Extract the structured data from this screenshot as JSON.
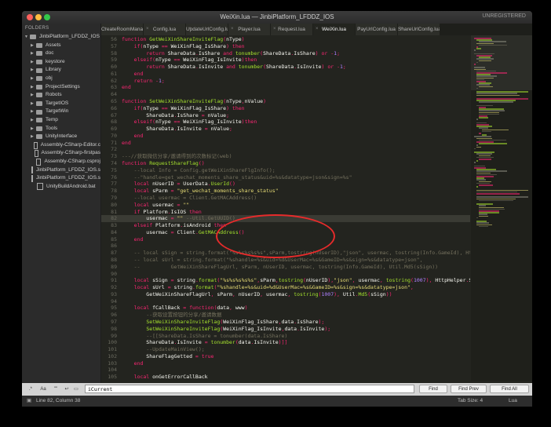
{
  "window": {
    "title": "WeiXin.lua — JinbiPlatform_LFDDZ_IOS",
    "registration": "UNREGISTERED"
  },
  "sidebar": {
    "header": "FOLDERS",
    "items": [
      {
        "label": "JinbiPlatform_LFDDZ_IOS",
        "kind": "folder",
        "expanded": true,
        "depth": 0
      },
      {
        "label": "Assets",
        "kind": "folder",
        "depth": 1
      },
      {
        "label": "doc",
        "kind": "folder",
        "depth": 1
      },
      {
        "label": "keystore",
        "kind": "folder",
        "depth": 1
      },
      {
        "label": "Library",
        "kind": "folder",
        "depth": 1
      },
      {
        "label": "obj",
        "kind": "folder",
        "depth": 1
      },
      {
        "label": "ProjectSettings",
        "kind": "folder",
        "depth": 1
      },
      {
        "label": "Robots",
        "kind": "folder",
        "depth": 1
      },
      {
        "label": "TargetIOS",
        "kind": "folder",
        "depth": 1
      },
      {
        "label": "TargetWin",
        "kind": "folder",
        "depth": 1
      },
      {
        "label": "Temp",
        "kind": "folder",
        "depth": 1
      },
      {
        "label": "Tools",
        "kind": "folder",
        "depth": 1
      },
      {
        "label": "UnityInterface",
        "kind": "folder",
        "depth": 1
      },
      {
        "label": "Assembly-CSharp-Editor.c",
        "kind": "file",
        "depth": 1
      },
      {
        "label": "Assembly-CSharp-firstpas",
        "kind": "file",
        "depth": 1
      },
      {
        "label": "Assembly-CSharp.csproj",
        "kind": "file",
        "depth": 1
      },
      {
        "label": "JinbiPlatform_LFDDZ_IOS.s",
        "kind": "file",
        "depth": 1
      },
      {
        "label": "JinbiPlatform_LFDDZ_IOS.s",
        "kind": "file",
        "depth": 1
      },
      {
        "label": "UnityBuildAndroid.bat",
        "kind": "file",
        "depth": 1
      }
    ]
  },
  "tabs": [
    {
      "label": "CreateRoomManager.lua",
      "active": false
    },
    {
      "label": "Config.lua",
      "active": false
    },
    {
      "label": "UpdateUrlConfig.lua",
      "active": false
    },
    {
      "label": "Player.lua",
      "active": false
    },
    {
      "label": "Request.lua",
      "active": false
    },
    {
      "label": "WeiXin.lua",
      "active": true
    },
    {
      "label": "PayUrlConfig.lua",
      "active": false
    },
    {
      "label": "ShareUrlConfig.lua",
      "active": false
    }
  ],
  "editor": {
    "current_line": 82,
    "lines": [
      {
        "n": 56,
        "code": "function GetWeiXinShareInviteFlag(nType)"
      },
      {
        "n": 57,
        "code": "    if(nType == WeiXinFlag_IsShare) then"
      },
      {
        "n": 58,
        "code": "        return ShareData.IsShare and tonumber(ShareData.IsShare) or -1;"
      },
      {
        "n": 59,
        "code": "    elseif(nType == WeiXinFlag_IsInvite)then"
      },
      {
        "n": 60,
        "code": "        return ShareData.IsInvite and tonumber(ShareData.IsInvite) or -1;"
      },
      {
        "n": 61,
        "code": "    end"
      },
      {
        "n": 62,
        "code": "    return -1;"
      },
      {
        "n": 63,
        "code": "end"
      },
      {
        "n": 64,
        "code": ""
      },
      {
        "n": 65,
        "code": "function SetWeiXinShareInviteFlag(nType,nValue)"
      },
      {
        "n": 66,
        "code": "    if(nType == WeiXinFlag_IsShare) then"
      },
      {
        "n": 67,
        "code": "        ShareData.IsShare = nValue;"
      },
      {
        "n": 68,
        "code": "    elseif(nType == WeiXinFlag_IsInvite)then"
      },
      {
        "n": 69,
        "code": "        ShareData.IsInvite = nValue;"
      },
      {
        "n": 70,
        "code": "    end"
      },
      {
        "n": 71,
        "code": "end"
      },
      {
        "n": 72,
        "code": ""
      },
      {
        "n": 73,
        "code": "---//获取微信分享/邀请得到的次数标记(web)"
      },
      {
        "n": 74,
        "code": "function RequestShareFlag()"
      },
      {
        "n": 75,
        "code": "    --local Info = Config.getWeiXinShareFlgInfo();"
      },
      {
        "n": 76,
        "code": "    --\"handle=get_wechat_moments_share_status&uid=%s&datatype=json&sign=%s\""
      },
      {
        "n": 77,
        "code": "    local nUserID = UserData.UserId()"
      },
      {
        "n": 78,
        "code": "    local sParm = \"get_wechat_moments_share_status\""
      },
      {
        "n": 79,
        "code": "    --local usermac = Client.GetMACAddress()"
      },
      {
        "n": 80,
        "code": "    local usermac = \"\""
      },
      {
        "n": 81,
        "code": "    if Platform.IsIOS then"
      },
      {
        "n": 82,
        "code": "        usermac = \"\" --Util.GetUUID()"
      },
      {
        "n": 83,
        "code": "    elseif Platform.isAndroid then"
      },
      {
        "n": 84,
        "code": "        usermac = Client.GetMACAddress()"
      },
      {
        "n": 85,
        "code": "    end"
      },
      {
        "n": 86,
        "code": ""
      },
      {
        "n": 87,
        "code": "    -- local sSign = string.format(\"%s%s%s%s%s\",sParm,tostring(nUserID),\"json\", usermac, tostring(Info.GameId), HttpHelper.SECURITY_KEY)"
      },
      {
        "n": 88,
        "code": "    -- local sUrl = string.format(\"%shandle=%s&uid=%d&UserMac=%s&GameID=%s&sign=%s&datatype=json\","
      },
      {
        "n": 89,
        "code": "    --          GetWeiXinShareFlagUrl, sParm, nUserID, usermac, tostring(Info.GameId), Util.Md5(sSign))"
      },
      {
        "n": 90,
        "code": ""
      },
      {
        "n": 91,
        "code": "    local sSign = string.format(\"%s%s%s%s%s\",sParm,tostring(nUserID),\"json\", usermac, tostring(1007), HttpHelper.SECURITY_KEY)"
      },
      {
        "n": 92,
        "code": "    local sUrl = string.format(\"%shandle=%s&uid=%d&UserMac=%s&GameID=%s&sign=%s&datatype=json\","
      },
      {
        "n": 93,
        "code": "        GetWeiXinShareFlagUrl, sParm, nUserID, usermac, tostring(1007), Util.Md5(sSign))"
      },
      {
        "n": 94,
        "code": ""
      },
      {
        "n": 95,
        "code": "    local fCallBack = function(data, www)"
      },
      {
        "n": 96,
        "code": "        --获取设置按钮的分享/邀请数据"
      },
      {
        "n": 97,
        "code": "        SetWeiXinShareInviteFlag(WeiXinFlag_IsShare,data.IsShare);"
      },
      {
        "n": 98,
        "code": "        SetWeiXinShareInviteFlag(WeiXinFlag_IsInvite,data.IsInvite);"
      },
      {
        "n": 99,
        "code": "        --[[ShareData.IsShare = tonumber(data.IsShare)"
      },
      {
        "n": 100,
        "code": "        ShareData.IsInvite = tonumber(data.IsInvite)]]"
      },
      {
        "n": 101,
        "code": "        --UpdateMainView();"
      },
      {
        "n": 102,
        "code": "        ShareFlagGetted = true"
      },
      {
        "n": 103,
        "code": "    end"
      },
      {
        "n": 104,
        "code": ""
      },
      {
        "n": 105,
        "code": "    local onGetErrorCallBack"
      },
      {
        "n": 106,
        "code": "    --连接出错后，预估重新请求，重新请求成功后会请求到WEB"
      },
      {
        "n": 107,
        "code": "    onGetErrorCallBack = function(error)"
      },
      {
        "n": 108,
        "code": "        if GetCount < 50 then"
      },
      {
        "n": 109,
        "code": "            HttpProcesser.HttpGetJson(sUrl, fCallBack, onGetErrorCallBack)"
      },
      {
        "n": 110,
        "code": "            GetCount = GetCount + 1"
      },
      {
        "n": 111,
        "code": "        else"
      },
      {
        "n": 112,
        "code": "            GetCount = 0"
      }
    ]
  },
  "findbar": {
    "opt_regex": ".*",
    "opt_case": "Aa",
    "opt_word": "\"\"",
    "query": "iCurrent",
    "find_label": "Find",
    "find_prev_label": "Find Prev",
    "find_all_label": "Find All"
  },
  "status": {
    "position": "Line 82, Column 38",
    "tab_size": "Tab Size: 4",
    "syntax": "Lua"
  },
  "colors": {
    "keyword": "#f92672",
    "function": "#a6e22e",
    "string": "#e6db74",
    "comment": "#75715e",
    "number": "#ae81ff",
    "annotation": "#e62b2b"
  }
}
